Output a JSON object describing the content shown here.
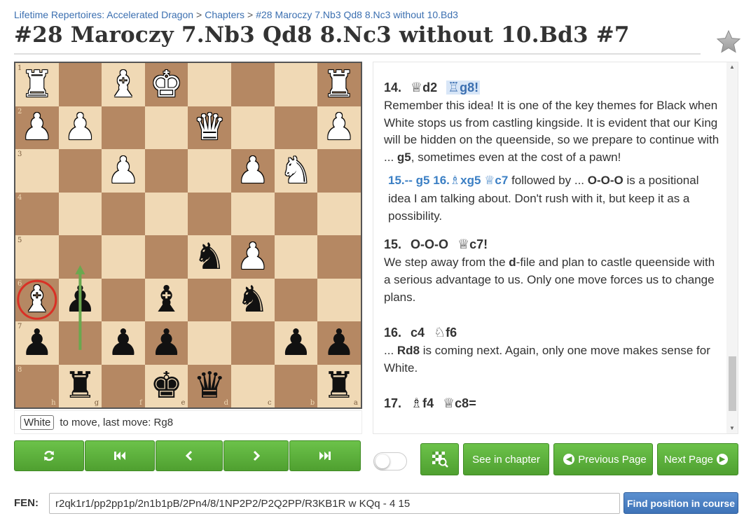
{
  "breadcrumb": {
    "course": "Lifetime Repertoires: Accelerated Dragon",
    "section": "Chapters",
    "chapter": "#28 Maroczy 7.Nb3 Qd8 8.Nc3 without 10.Bd3",
    "separator": ">"
  },
  "page_title": "#28 Maroczy 7.Nb3 Qd8 8.Nc3 without 10.Bd3 #7",
  "board": {
    "orientation": "black",
    "rank_labels": [
      "1",
      "2",
      "3",
      "4",
      "5",
      "6",
      "7",
      "8"
    ],
    "file_labels": [
      "h",
      "g",
      "f",
      "e",
      "d",
      "c",
      "b",
      "a"
    ],
    "light_color": "#f0d9b5",
    "dark_color": "#b58863",
    "fen_placement": "r2qk1r1/pp2pp1p/2n1b1pB/2Pn4/8/1NP2P2/P2Q2PP/R3KB1R",
    "last_move": {
      "from": "h8",
      "to": "g8"
    },
    "arrow": {
      "from": "g7",
      "to": "g5",
      "color": "#6aa84f"
    },
    "circle": {
      "square": "h6",
      "color": "#d93025"
    }
  },
  "status": {
    "side": "White",
    "text": "to move, last move: Rg8"
  },
  "nav_buttons": [
    {
      "name": "flip-board-button",
      "icon": "refresh-icon",
      "glyph": "⟲"
    },
    {
      "name": "first-move-button",
      "icon": "first-icon",
      "glyph": "⏮"
    },
    {
      "name": "prev-move-button",
      "icon": "prev-icon",
      "glyph": "‹"
    },
    {
      "name": "next-move-button",
      "icon": "next-icon",
      "glyph": "›"
    },
    {
      "name": "last-move-button",
      "icon": "last-icon",
      "glyph": "⏭"
    }
  ],
  "actions": {
    "see_in_chapter": "See in chapter",
    "previous_page": "Previous Page",
    "next_page": "Next Page"
  },
  "comments": {
    "m14": {
      "num": "14.",
      "w_sym": "♕",
      "w_sq": "d2",
      "b_sym": "♖",
      "b_sq": "g8!"
    },
    "c14": "Remember this idea! It is one of the key themes for Black when White stops us from castling kingside. It is evident that our King will be hidden on the queenside, so we prepare to continue with ... g5, sometimes even at the cost of a pawn!",
    "var_moves": "15.-- g5 16.",
    "var_b_sym": "♗",
    "var_sq": "xg5",
    "var_q_sym": "♕",
    "var_q_sq": "c7",
    "var_rest": "followed by ... O-O-O is a positional idea I am talking about. Don't rush with it, but keep it as a possibility.",
    "m15": {
      "num": "15.",
      "w": "O-O-O",
      "b_sym": "♕",
      "b_sq": "c7!"
    },
    "c15": "We step away from the d-file and plan to castle queenside with a serious advantage to us. Only one move forces us to change plans.",
    "m16": {
      "num": "16.",
      "w": "c4",
      "b_sym": "♘",
      "b_sq": "f6"
    },
    "c16": "... Rd8 is coming next. Again, only one move makes sense for White.",
    "m17": {
      "num": "17.",
      "w_sym": "♗",
      "w_sq": "f4",
      "b_sym": "♕",
      "b_sq": "c8="
    }
  },
  "fen": {
    "label": "FEN:",
    "value": "r2qk1r1/pp2pp1p/2n1b1pB/2Pn4/8/1NP2P2/P2Q2PP/R3KB1R w KQq - 4 15"
  },
  "find_position": "Find position in course",
  "accent": {
    "green": "#5cb23b",
    "blue": "#3f74b8",
    "link": "#3b6fb0"
  }
}
